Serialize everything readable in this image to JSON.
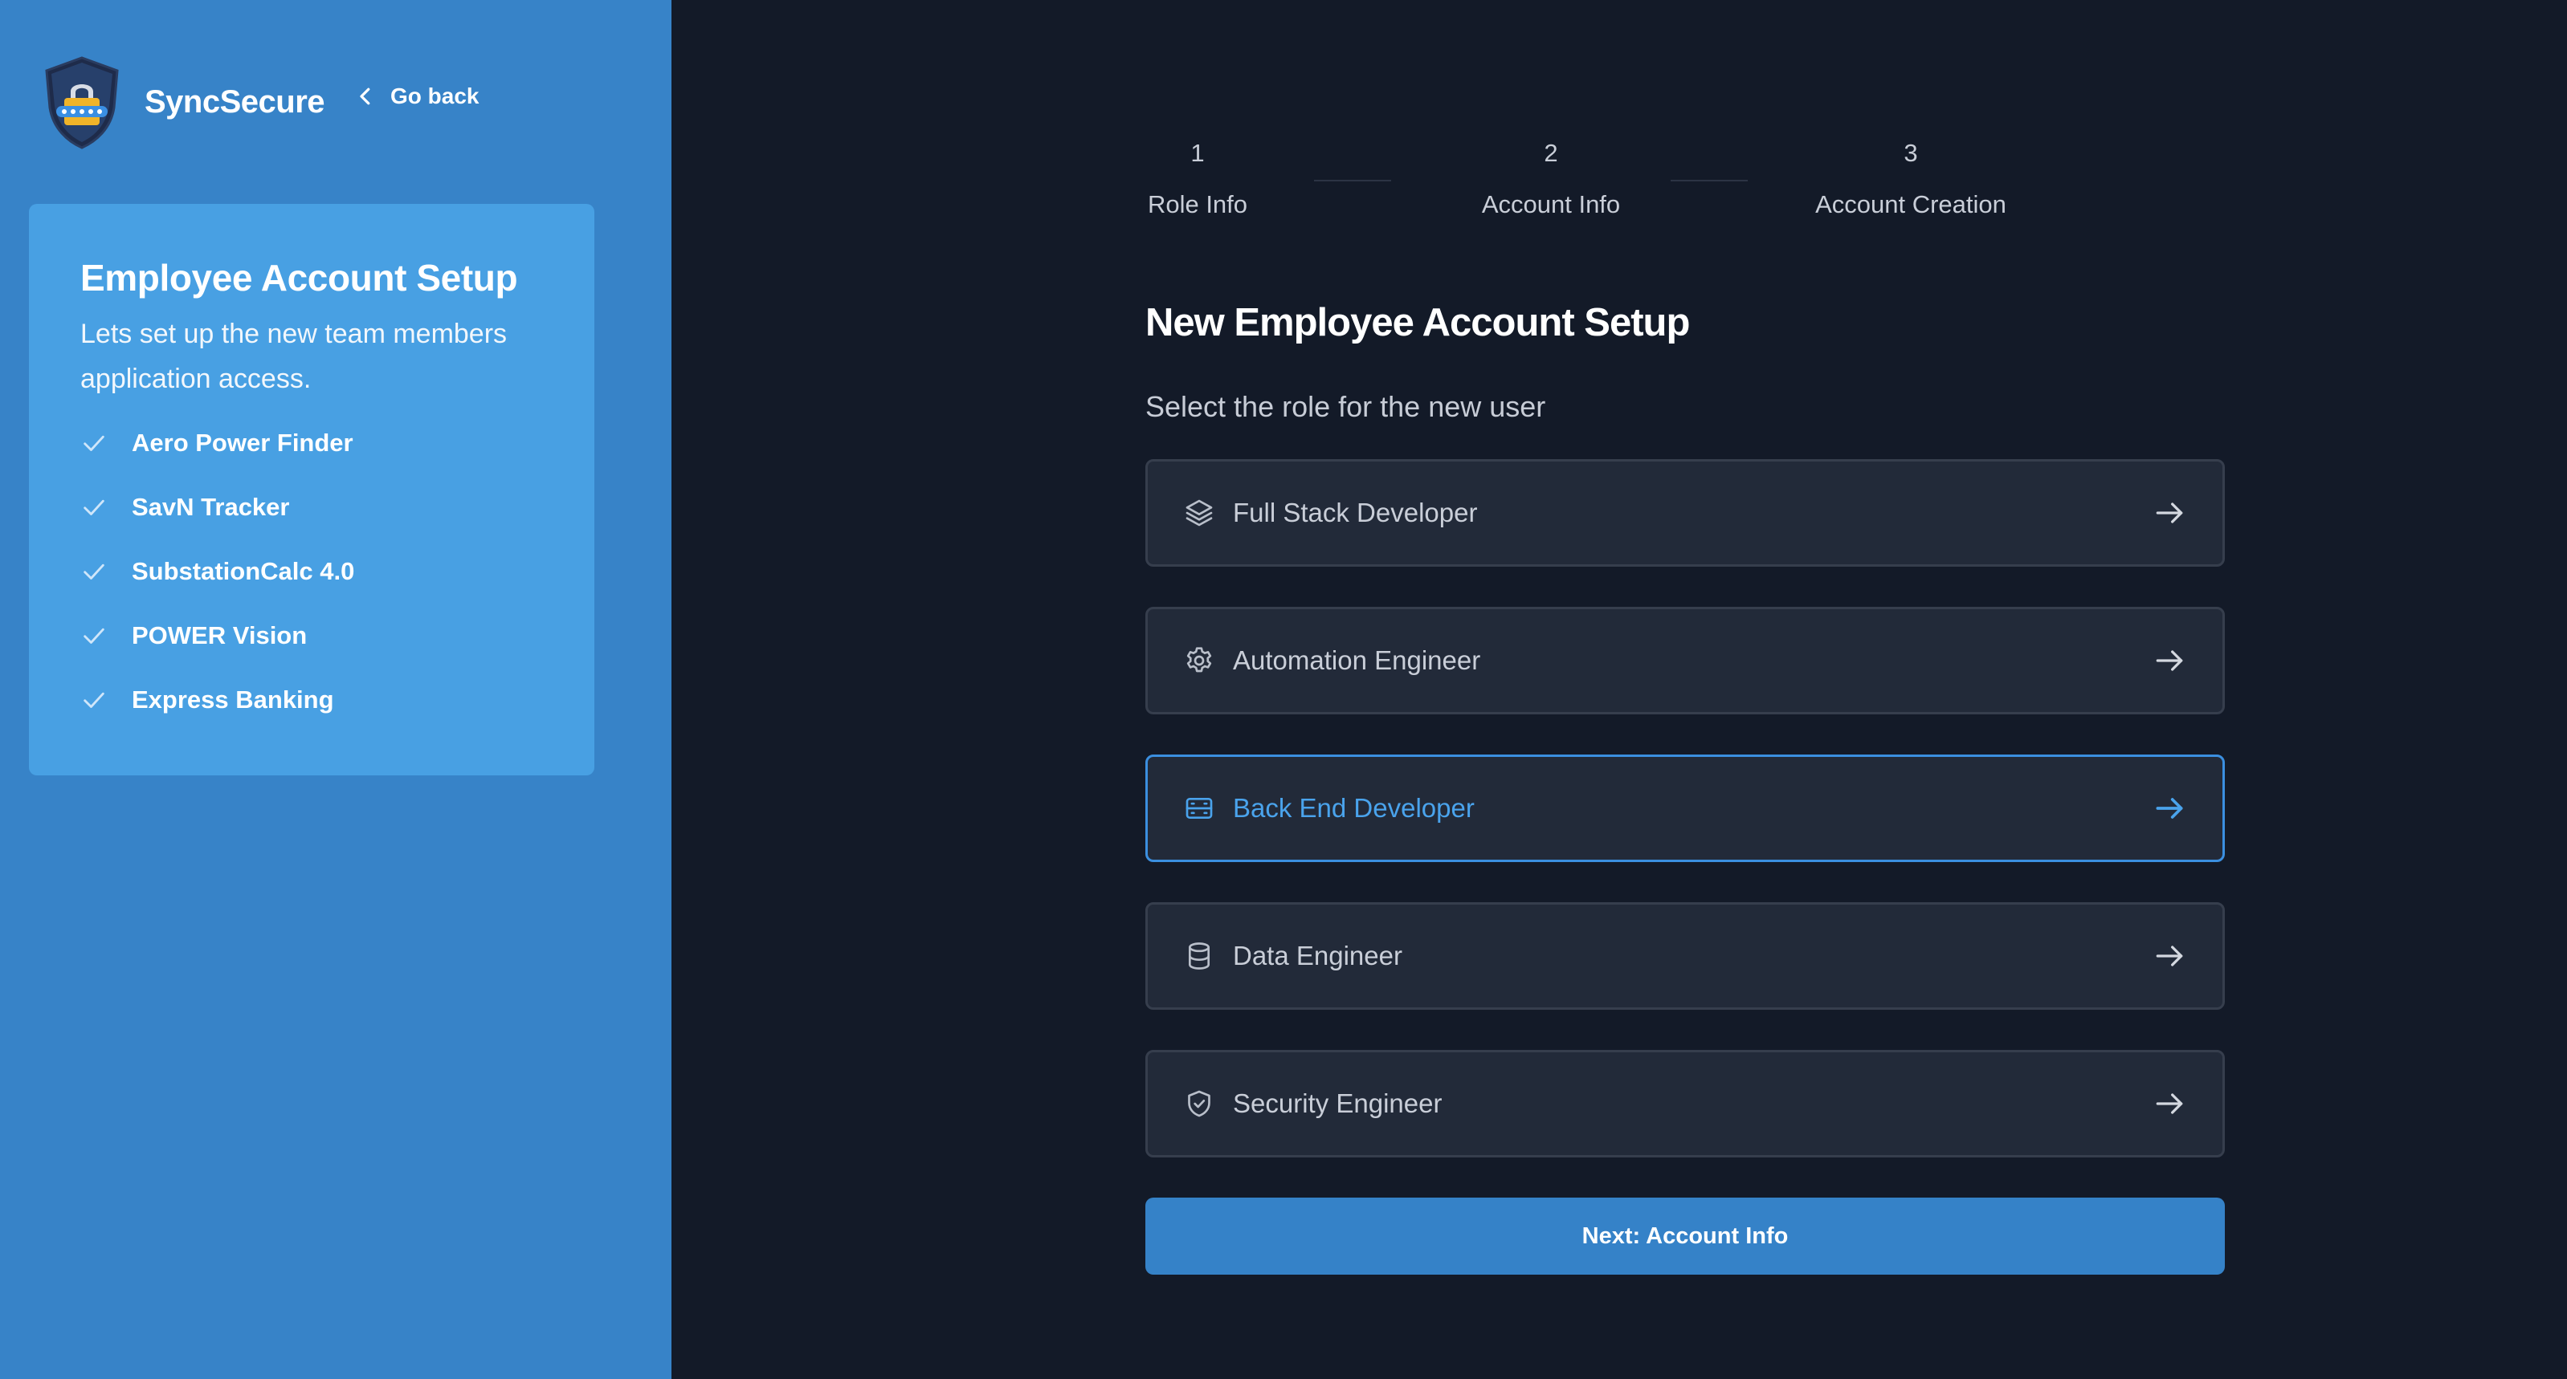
{
  "brand": {
    "name": "SyncSecure",
    "logo_icon": "shield-lock-icon"
  },
  "nav": {
    "go_back": "Go back"
  },
  "card": {
    "title": "Employee Account Setup",
    "subtitle": "Lets set up the new team members application access.",
    "apps": [
      "Aero Power Finder",
      "SavN Tracker",
      "SubstationCalc 4.0",
      "POWER Vision",
      "Express Banking"
    ]
  },
  "steps": [
    {
      "number": "1",
      "label": "Role Info"
    },
    {
      "number": "2",
      "label": "Account Info"
    },
    {
      "number": "3",
      "label": "Account Creation"
    }
  ],
  "main": {
    "title": "New Employee Account Setup",
    "subtitle": "Select the role for the new user",
    "roles": [
      {
        "label": "Full Stack Developer",
        "icon": "layers-icon",
        "selected": false
      },
      {
        "label": "Automation Engineer",
        "icon": "gear-icon",
        "selected": false
      },
      {
        "label": "Back End Developer",
        "icon": "server-icon",
        "selected": true
      },
      {
        "label": "Data Engineer",
        "icon": "database-icon",
        "selected": false
      },
      {
        "label": "Security Engineer",
        "icon": "shield-check-icon",
        "selected": false
      }
    ],
    "next_button": "Next: Account Info"
  },
  "colors": {
    "sidebar": "#3783c8",
    "card": "#48a0e3",
    "background": "#131a28",
    "accent": "#3b8fe0",
    "button": "#3582c8"
  }
}
